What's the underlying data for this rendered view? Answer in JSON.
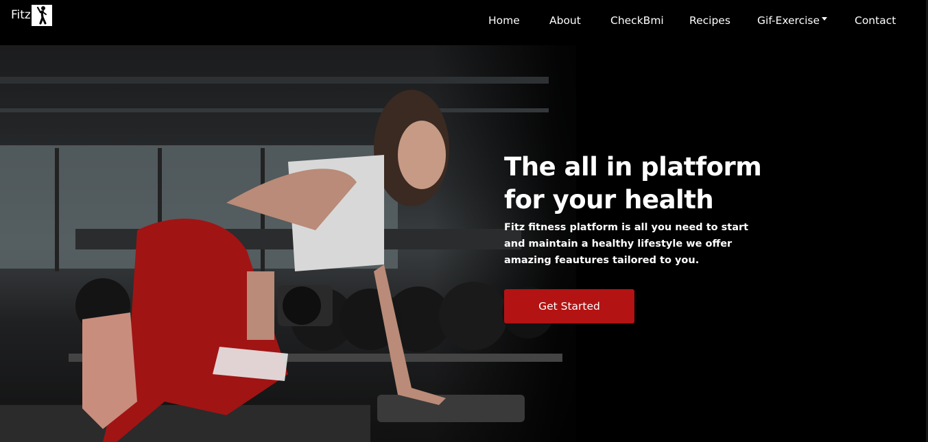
{
  "brand": {
    "name": "Fitz",
    "logo_icon": "fitness-figure-icon"
  },
  "nav": {
    "items": [
      {
        "label": "Home"
      },
      {
        "label": "About"
      },
      {
        "label": "CheckBmi"
      },
      {
        "label": "Recipes"
      },
      {
        "label": "Gif-Exercise",
        "has_dropdown": true
      },
      {
        "label": "Contact"
      }
    ]
  },
  "hero": {
    "title_line1": "The all in platform",
    "title_line2": "for your health",
    "subtitle": "Fitz fitness platform is all you need to start and maintain a healthy lifestyle we offer amazing feautures tailored to you.",
    "cta_label": "Get Started"
  },
  "colors": {
    "accent": "#b31313",
    "background": "#000000",
    "text": "#ffffff"
  }
}
